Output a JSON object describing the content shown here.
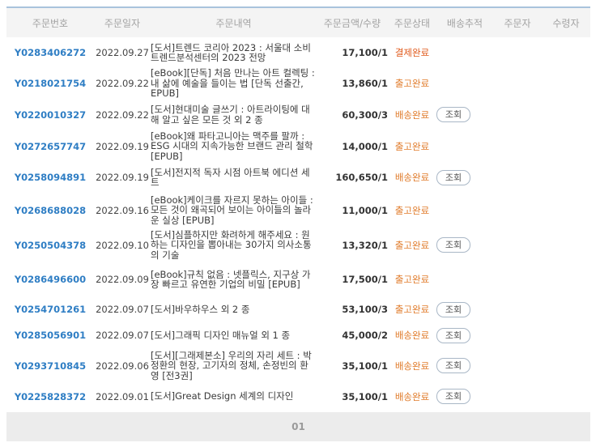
{
  "columns": [
    "주문번호",
    "주문일자",
    "주문내역",
    "주문금액/수량",
    "주문상태",
    "배송추적",
    "주문자",
    "수령자"
  ],
  "track_label": "조회",
  "rows": [
    {
      "no": "Y0283406272",
      "date": "2022.09.27",
      "desc": "[도서]트렌드 코리아 2023 : 서울대 소비트렌드분석센터의 2023 전망",
      "amount": "17,100/1",
      "status": "결제완료",
      "status_color": "#e05a1c",
      "track": false
    },
    {
      "no": "Y0218021754",
      "date": "2022.09.22",
      "desc": "[eBook][단독] 처음 만나는 아트 컬렉팅 : 내 삶에 예술을 들이는 법 [단독 선출간, EPUB]",
      "amount": "13,860/1",
      "status": "출고완료",
      "status_color": "#e07b2a",
      "track": false
    },
    {
      "no": "Y0220010327",
      "date": "2022.09.22",
      "desc": "[도서]현대미술 글쓰기 : 아트라이팅에 대해 알고 싶은 모든 것 외 2 종",
      "amount": "60,300/3",
      "status": "배송완료",
      "status_color": "#e07b2a",
      "track": true
    },
    {
      "no": "Y0272657747",
      "date": "2022.09.19",
      "desc": "[eBook]왜 파타고니아는 맥주를 팔까 : ESG 시대의 지속가능한 브랜드 관리 철학 [EPUB]",
      "amount": "14,000/1",
      "status": "출고완료",
      "status_color": "#e07b2a",
      "track": false
    },
    {
      "no": "Y0258094891",
      "date": "2022.09.19",
      "desc": "[도서]전지적 독자 시점 아트북 에디션 세트",
      "amount": "160,650/1",
      "status": "배송완료",
      "status_color": "#e07b2a",
      "track": true
    },
    {
      "no": "Y0268688028",
      "date": "2022.09.16",
      "desc": "[eBook]케이크를 자르지 못하는 아이들 : 모든 것이 왜곡되어 보이는 아이들의 놀라운 실상 [EPUB]",
      "amount": "11,000/1",
      "status": "출고완료",
      "status_color": "#e07b2a",
      "track": false
    },
    {
      "no": "Y0250504378",
      "date": "2022.09.10",
      "desc": "[도서]심플하지만 화려하게 해주세요 : 원하는 디자인을 뽑아내는 30가지 의사소통의 기술",
      "amount": "13,320/1",
      "status": "출고완료",
      "status_color": "#e07b2a",
      "track": true
    },
    {
      "no": "Y0286496600",
      "date": "2022.09.09",
      "desc": "[eBook]규칙 없음 : 넷플릭스, 지구상 가장 빠르고 유연한 기업의 비밀 [EPUB]",
      "amount": "17,500/1",
      "status": "출고완료",
      "status_color": "#e07b2a",
      "track": false
    },
    {
      "no": "Y0254701261",
      "date": "2022.09.07",
      "desc": "[도서]바우하우스 외 2 종",
      "amount": "53,100/3",
      "status": "출고완료",
      "status_color": "#e07b2a",
      "track": true
    },
    {
      "no": "Y0285056901",
      "date": "2022.09.07",
      "desc": "[도서]그래픽 디자인 매뉴얼 외 1 종",
      "amount": "45,000/2",
      "status": "배송완료",
      "status_color": "#e07b2a",
      "track": true
    },
    {
      "no": "Y0293710845",
      "date": "2022.09.06",
      "desc": "[도서][그래제본소] 우리의 자리 세트 : 박정환의 현장, 고기자의 정체, 손정빈의 환영 [전3권]",
      "amount": "35,100/1",
      "status": "배송완료",
      "status_color": "#e07b2a",
      "track": true
    },
    {
      "no": "Y0225828372",
      "date": "2022.09.01",
      "desc": "[도서]Great Design 세계의 디자인",
      "amount": "35,100/1",
      "status": "배송완료",
      "status_color": "#e07b2a",
      "track": true
    }
  ],
  "pagination": {
    "current": "01"
  }
}
